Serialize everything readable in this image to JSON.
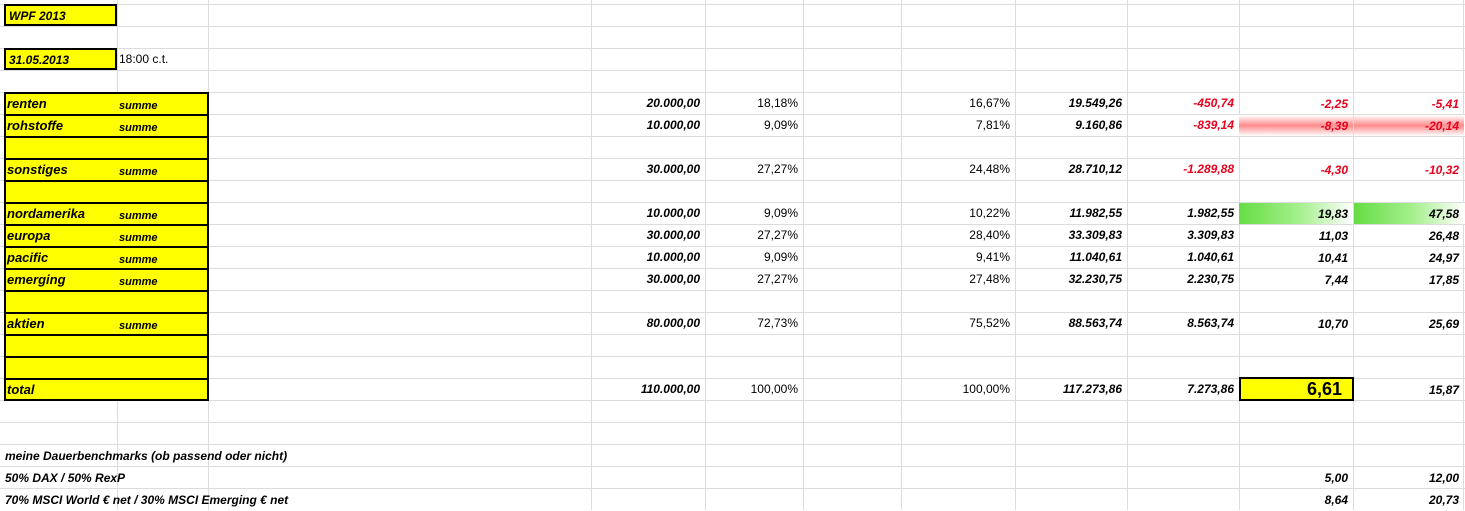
{
  "header": {
    "title": "WPF 2013",
    "date": "31.05.2013",
    "time": "18:00 c.t."
  },
  "rows": [
    {
      "name": "renten",
      "tag": "summe",
      "amount": "20.000,00",
      "pct1": "18,18%",
      "pct2": "16,67%",
      "value": "19.549,26",
      "diff": "-450,74",
      "r1": "-2,25",
      "r2": "-5,41",
      "diff_neg": true,
      "r_neg": true,
      "style": ""
    },
    {
      "name": "rohstoffe",
      "tag": "summe",
      "amount": "10.000,00",
      "pct1": "9,09%",
      "pct2": "7,81%",
      "value": "9.160,86",
      "diff": "-839,14",
      "r1": "-8,39",
      "r2": "-20,14",
      "diff_neg": true,
      "r_neg": true,
      "style": "red"
    },
    {
      "name": "",
      "tag": "",
      "amount": "",
      "pct1": "",
      "pct2": "",
      "value": "",
      "diff": "",
      "r1": "",
      "r2": "",
      "style": ""
    },
    {
      "name": "sonstiges",
      "tag": "summe",
      "amount": "30.000,00",
      "pct1": "27,27%",
      "pct2": "24,48%",
      "value": "28.710,12",
      "diff": "-1.289,88",
      "r1": "-4,30",
      "r2": "-10,32",
      "diff_neg": true,
      "r_neg": true,
      "style": ""
    },
    {
      "name": "",
      "tag": "",
      "amount": "",
      "pct1": "",
      "pct2": "",
      "value": "",
      "diff": "",
      "r1": "",
      "r2": "",
      "style": ""
    },
    {
      "name": "nordamerika",
      "tag": "summe",
      "amount": "10.000,00",
      "pct1": "9,09%",
      "pct2": "10,22%",
      "value": "11.982,55",
      "diff": "1.982,55",
      "r1": "19,83",
      "r2": "47,58",
      "style": "green"
    },
    {
      "name": "europa",
      "tag": "summe",
      "amount": "30.000,00",
      "pct1": "27,27%",
      "pct2": "28,40%",
      "value": "33.309,83",
      "diff": "3.309,83",
      "r1": "11,03",
      "r2": "26,48",
      "style": ""
    },
    {
      "name": "pacific",
      "tag": "summe",
      "amount": "10.000,00",
      "pct1": "9,09%",
      "pct2": "9,41%",
      "value": "11.040,61",
      "diff": "1.040,61",
      "r1": "10,41",
      "r2": "24,97",
      "style": ""
    },
    {
      "name": "emerging",
      "tag": "summe",
      "amount": "30.000,00",
      "pct1": "27,27%",
      "pct2": "27,48%",
      "value": "32.230,75",
      "diff": "2.230,75",
      "r1": "7,44",
      "r2": "17,85",
      "style": ""
    },
    {
      "name": "",
      "tag": "",
      "amount": "",
      "pct1": "",
      "pct2": "",
      "value": "",
      "diff": "",
      "r1": "",
      "r2": "",
      "style": ""
    },
    {
      "name": "aktien",
      "tag": "summe",
      "amount": "80.000,00",
      "pct1": "72,73%",
      "pct2": "75,52%",
      "value": "88.563,74",
      "diff": "8.563,74",
      "r1": "10,70",
      "r2": "25,69",
      "style": ""
    },
    {
      "name": "",
      "tag": "",
      "amount": "",
      "pct1": "",
      "pct2": "",
      "value": "",
      "diff": "",
      "r1": "",
      "r2": "",
      "style": ""
    },
    {
      "name": "",
      "tag": "",
      "amount": "",
      "pct1": "",
      "pct2": "",
      "value": "",
      "diff": "",
      "r1": "",
      "r2": "",
      "style": ""
    },
    {
      "name": "total",
      "tag": "",
      "amount": "110.000,00",
      "pct1": "100,00%",
      "pct2": "100,00%",
      "value": "117.273,86",
      "diff": "7.273,86",
      "r1": "6,61",
      "r2": "15,87",
      "style": "total"
    }
  ],
  "benchmarks": {
    "heading": "meine Dauerbenchmarks (ob passend oder nicht)",
    "items": [
      {
        "label": "50% DAX / 50% RexP",
        "r1": "5,00",
        "r2": "12,00"
      },
      {
        "label": "70% MSCI World € net / 30% MSCI Emerging € net",
        "r1": "8,64",
        "r2": "20,73"
      }
    ]
  },
  "colors": {
    "highlight": "#ffff00",
    "negative": "#e8001c",
    "gridline": "#dadcdd"
  }
}
